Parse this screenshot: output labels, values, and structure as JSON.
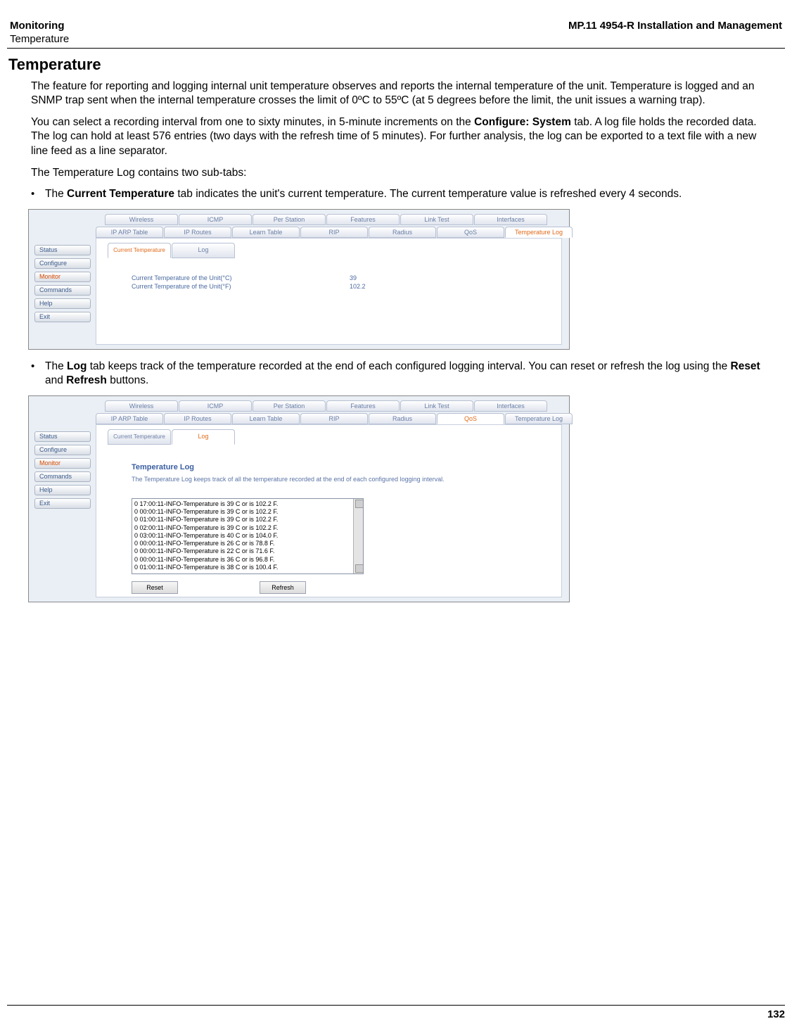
{
  "header": {
    "left_line1": "Monitoring",
    "left_line2": "Temperature",
    "right": "MP.11 4954-R Installation and Management"
  },
  "section_title": "Temperature",
  "paragraphs": {
    "p1": "The feature for reporting and logging internal unit temperature observes and reports the internal temperature of the unit. Temperature is logged and an SNMP trap sent when the internal temperature crosses the limit of 0ºC to 55ºC (at 5 degrees before the limit, the unit issues a warning trap).",
    "p2a": "You can select a recording interval from one to sixty minutes, in 5-minute increments on the ",
    "p2b": "Configure: System",
    "p2c": " tab. A log file holds the recorded data. The log can hold at least 576 entries (two days with the refresh time of 5 minutes). For further analysis, the log can be exported to a text file with a new line feed as a line separator.",
    "p3": "The Temperature Log contains two sub-tabs:"
  },
  "bullets": {
    "b1a": "The ",
    "b1b": "Current Temperature",
    "b1c": " tab indicates the unit's current temperature. The current temperature value is refreshed every 4 seconds.",
    "b2a": "The ",
    "b2b": "Log",
    "b2c": " tab keeps track of the temperature recorded at the end of each configured logging interval. You can reset or refresh the log using the ",
    "b2d": "Reset",
    "b2e": " and ",
    "b2f": "Refresh",
    "b2g": " buttons."
  },
  "sidebar": {
    "items": [
      "Status",
      "Configure",
      "Monitor",
      "Commands",
      "Help",
      "Exit"
    ]
  },
  "tabs_top": [
    "Wireless",
    "ICMP",
    "Per Station",
    "Features",
    "Link Test",
    "Interfaces"
  ],
  "tabs_bot": [
    "IP ARP Table",
    "IP Routes",
    "Learn Table",
    "RIP",
    "Radius",
    "QoS",
    "Temperature Log"
  ],
  "sub_tabs": {
    "current": "Current Temperature",
    "log": "Log"
  },
  "fig1": {
    "label_c": "Current Temperature of the Unit(°C)",
    "label_f": "Current Temperature of the Unit(°F)",
    "val_c": "39",
    "val_f": "102.2",
    "active_tab_bot": "Temperature Log",
    "active_sub": "Current Temperature"
  },
  "fig2": {
    "title": "Temperature Log",
    "desc": "The Temperature Log keeps track of all the temperature recorded at the end of each configured logging interval.",
    "entries": [
      "0 17:00:11-INFO-Temperature is 39 C or is 102.2 F.",
      "0 00:00:11-INFO-Temperature is 39 C or is 102.2 F.",
      "0 01:00:11-INFO-Temperature is 39 C or is 102.2 F.",
      "0 02:00:11-INFO-Temperature is 39 C or is 102.2 F.",
      "0 03:00:11-INFO-Temperature is 40 C or is 104.0 F.",
      "0 00:00:11-INFO-Temperature is 26 C or is 78.8 F.",
      "0 00:00:11-INFO-Temperature is 22 C or is 71.6 F.",
      "0 00:00:11-INFO-Temperature is 36 C or is 96.8 F.",
      "0 01:00:11-INFO-Temperature is 38 C or is 100.4 F."
    ],
    "reset": "Reset",
    "refresh": "Refresh",
    "active_tab_bot": "QoS",
    "active_sub": "Log"
  },
  "footer": {
    "page": "132"
  }
}
